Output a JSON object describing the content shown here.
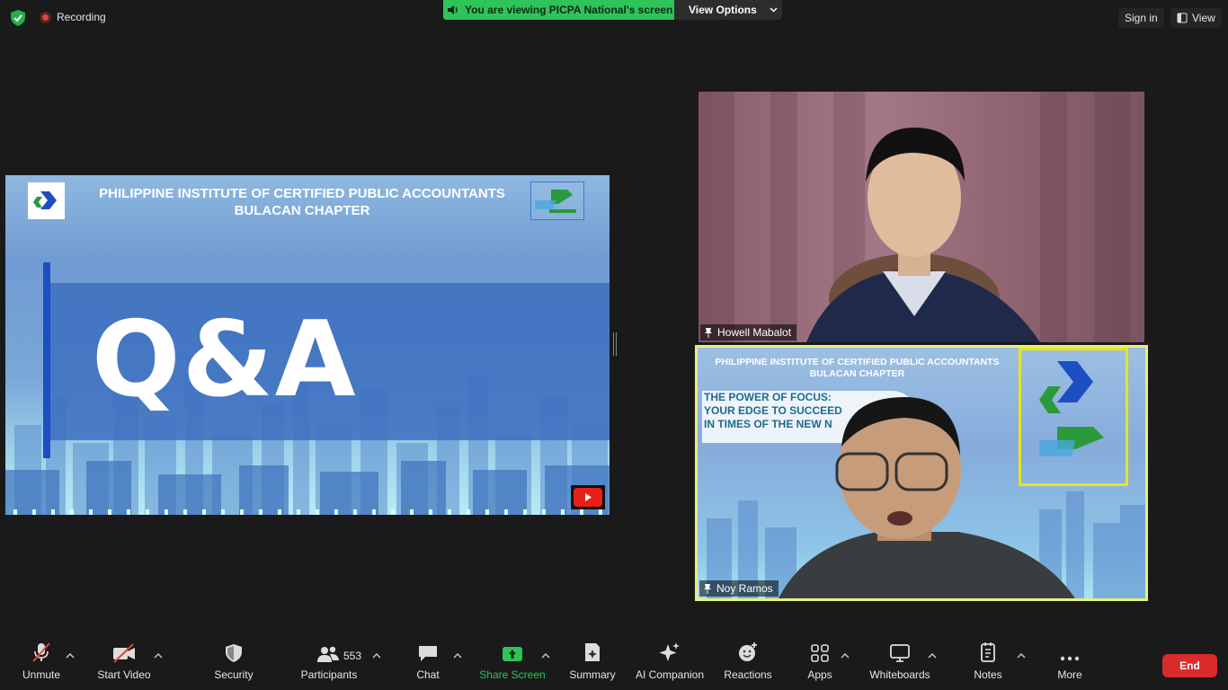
{
  "topbar": {
    "recording_label": "Recording",
    "viewing_label": "You are viewing PICPA National's screen",
    "view_options_label": "View Options",
    "signin_label": "Sign in",
    "view_label": "View"
  },
  "slide": {
    "title_line1": "PHILIPPINE INSTITUTE OF CERTIFIED PUBLIC ACCOUNTANTS",
    "title_line2": "BULACAN CHAPTER",
    "heading": "Q&A"
  },
  "participants": {
    "howell": {
      "name": "Howell Mabalot"
    },
    "noy": {
      "name": "Noy Ramos",
      "bg_title_line1": "PHILIPPINE INSTITUTE OF CERTIFIED PUBLIC ACCOUNTANTS",
      "bg_title_line2": "BULACAN CHAPTER",
      "bg_focus_line1": "THE POWER OF FOCUS:",
      "bg_focus_line2": "YOUR EDGE TO SUCCEED",
      "bg_focus_line3": "IN TIMES OF THE NEW N"
    }
  },
  "toolbar": {
    "unmute": "Unmute",
    "start_video": "Start Video",
    "security": "Security",
    "participants": "Participants",
    "participants_count": "553",
    "chat": "Chat",
    "share_screen": "Share Screen",
    "summary": "Summary",
    "ai_companion": "AI Companion",
    "reactions": "Reactions",
    "apps": "Apps",
    "whiteboards": "Whiteboards",
    "notes": "Notes",
    "more": "More",
    "end": "End"
  },
  "colors": {
    "viewing_banner": "#2ec45a",
    "active_speaker_border": "#e6f07a",
    "end_button": "#d92b2b",
    "share_screen_accent": "#2ec45a"
  },
  "icons": [
    "shield-icon",
    "record-icon",
    "speaker-icon",
    "chevron-down-icon",
    "view-icon",
    "pin-icon",
    "mic-off-icon",
    "video-off-icon",
    "security-icon",
    "participants-icon",
    "chat-icon",
    "share-screen-icon",
    "summary-icon",
    "ai-companion-icon",
    "reactions-icon",
    "apps-icon",
    "whiteboards-icon",
    "notes-icon",
    "more-icon",
    "caret-up-icon"
  ]
}
